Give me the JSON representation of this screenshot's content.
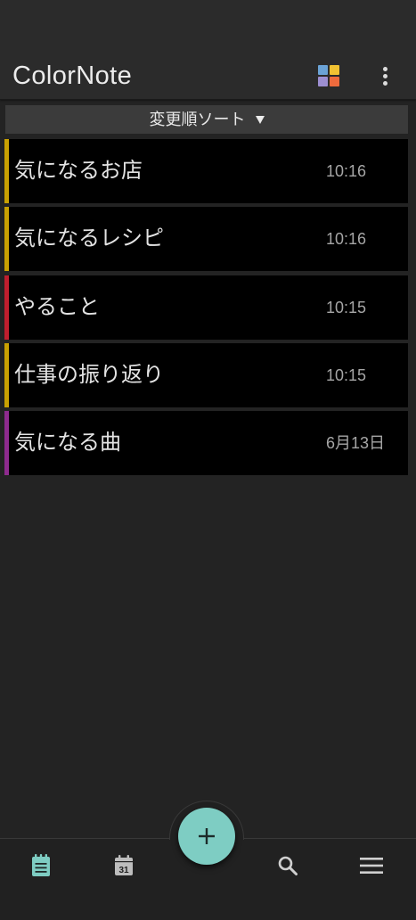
{
  "app": {
    "title": "ColorNote"
  },
  "toolbar": {
    "palette_icon": "color-palette-icon",
    "palette_colors": [
      "#6ba3d6",
      "#f1c232",
      "#9d8fd1",
      "#ee6b3d"
    ],
    "more_icon": "more-vert-icon"
  },
  "sort": {
    "label": "変更順ソート",
    "arrow_icon": "caret-down-icon"
  },
  "notes": [
    {
      "title": "気になるお店",
      "time": "10:16",
      "color": "#c9a102"
    },
    {
      "title": "気になるレシピ",
      "time": "10:16",
      "color": "#c9a102"
    },
    {
      "title": "やること",
      "time": "10:15",
      "color": "#bf1e2e"
    },
    {
      "title": "仕事の振り返り",
      "time": "10:15",
      "color": "#c9a102"
    },
    {
      "title": "気になる曲",
      "time": "6月13日",
      "color": "#8e2b8e"
    }
  ],
  "bottom_nav": {
    "items": [
      {
        "icon": "notes-icon",
        "active": true
      },
      {
        "icon": "calendar-icon",
        "day": "31"
      },
      {
        "icon": "search-icon"
      },
      {
        "icon": "menu-icon"
      }
    ],
    "fab_icon": "add-icon"
  },
  "colors": {
    "background": "#232323",
    "header": "#2b2b2b",
    "sort_bar": "#3b3b3b",
    "note_background": "#000000",
    "accent": "#7ecdc3",
    "title_text": "#e3e3e3",
    "time_text": "#a6a6a6",
    "icon": "#d0d0d0"
  }
}
